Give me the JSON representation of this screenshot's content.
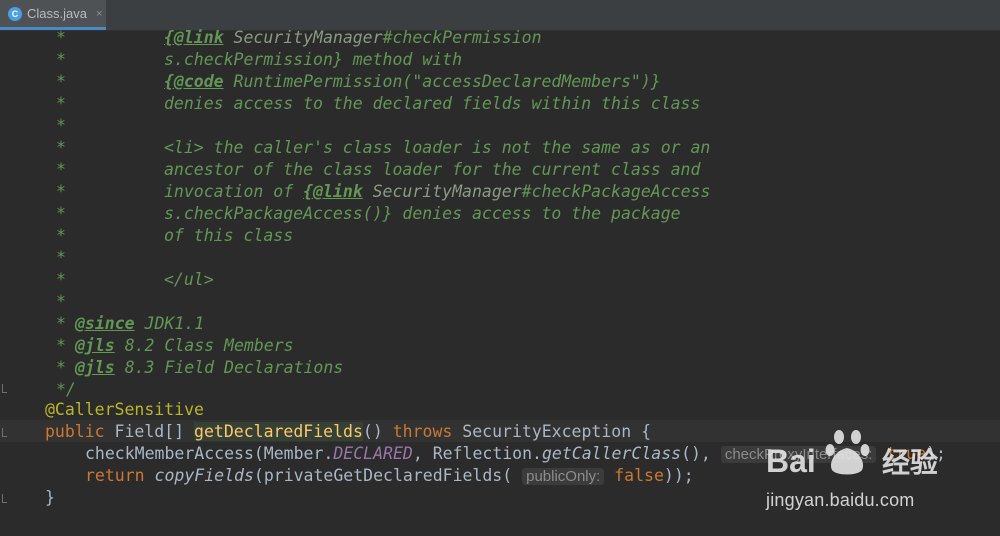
{
  "tab": {
    "filename": "Class.java",
    "icon_letter": "C",
    "close": "×",
    "icon": "java-class-icon"
  },
  "code": {
    "l1": {
      "star": "*",
      "tag": "{@link",
      "ref": "SecurityManager",
      "rest": "#checkPermission"
    },
    "l2": {
      "star": "*",
      "text": "s.checkPermission} method with"
    },
    "l3": {
      "star": "*",
      "tag": "{@code",
      "text": "RuntimePermission(\"accessDeclaredMembers\")}"
    },
    "l4": {
      "star": "*",
      "text": "denies access to the declared fields within this class"
    },
    "l5": {
      "star": "*"
    },
    "l6": {
      "star": "*",
      "text": "<li> the caller's class loader is not the same as or an"
    },
    "l7": {
      "star": "*",
      "text": "ancestor of the class loader for the current class and"
    },
    "l8": {
      "star": "*",
      "pre": "invocation of",
      "tag": "{@link",
      "ref": "SecurityManager",
      "rest": "#checkPackageAccess"
    },
    "l9": {
      "star": "*",
      "text": "s.checkPackageAccess()} denies access to the package"
    },
    "l10": {
      "star": "*",
      "text": "of this class"
    },
    "l11": {
      "star": "*"
    },
    "l12": {
      "star": "*",
      "text": "</ul>"
    },
    "l13": {
      "star": "*"
    },
    "l14": {
      "star": "*",
      "tag": "@since",
      "text": "JDK1.1"
    },
    "l15": {
      "star": "*",
      "tag": "@jls",
      "text": "8.2 Class Members"
    },
    "l16": {
      "star": "*",
      "tag": "@jls",
      "text": "8.3 Field Declarations"
    },
    "l17": {
      "text": "*/"
    },
    "l18": {
      "text": "@CallerSensitive"
    },
    "l19": {
      "kw1": "public",
      "type": "Field[]",
      "method": "getDeclaredFields",
      "paren": "()",
      "kw2": "throws",
      "exc": "SecurityException {"
    },
    "l20": {
      "fn": "checkMemberAccess(Member.",
      "const": "DECLARED",
      "mid": ", Reflection.",
      "call": "getCallerClass",
      "end": "(),",
      "hint": "checkProxyInterfaces:",
      "val": "true",
      "close": ");"
    },
    "l21": {
      "kw": "return",
      "fn": "copyFields",
      "mid": "(privateGetDeclaredFields(",
      "hint": "publicOnly:",
      "val": "false",
      "close": "));"
    },
    "l22": {
      "text": "}"
    }
  },
  "watermark": {
    "brand": "Bai",
    "brand2": "经验",
    "url": "jingyan.baidu.com"
  }
}
